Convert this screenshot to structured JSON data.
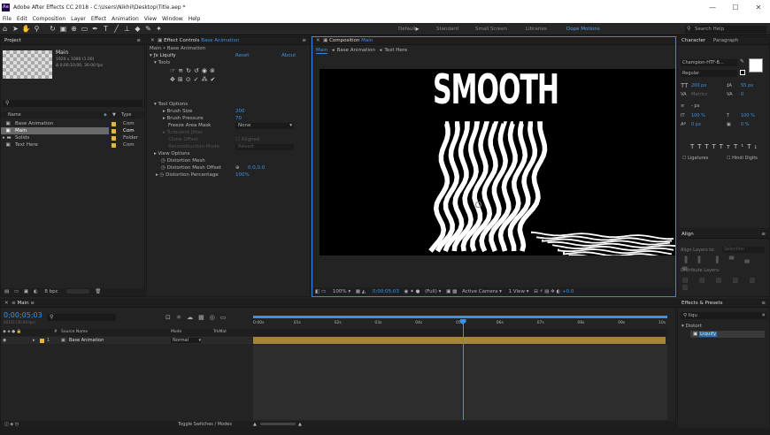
{
  "window": {
    "title": "Adobe After Effects CC 2018 - C:\\Users\\Nikhil\\Desktop\\Title.aep *",
    "app_icon": "Ae"
  },
  "menu": [
    "File",
    "Edit",
    "Composition",
    "Layer",
    "Effect",
    "Animation",
    "View",
    "Window",
    "Help"
  ],
  "workspaces": [
    "Default",
    "Standard",
    "Small Screen",
    "Libraries",
    "Dope Motions"
  ],
  "search_help_placeholder": "Search Help",
  "project": {
    "tab": "Project",
    "preview_name": "Main",
    "preview_info1": "1920 x 1080 (1.00)",
    "preview_info2": "Δ 0;00;10;00, 30.00 fps",
    "search_placeholder": "",
    "col_name": "Name",
    "col_type": "Type",
    "items": [
      {
        "name": "Base Animation",
        "type": "Com",
        "color": "#e5b53c",
        "selected": false
      },
      {
        "name": "Main",
        "type": "Com",
        "color": "#e5b53c",
        "selected": true
      },
      {
        "name": "Solids",
        "type": "Folder",
        "color": "#e5b53c",
        "selected": false
      },
      {
        "name": "Text Here",
        "type": "Com",
        "color": "#e5b53c",
        "selected": false
      }
    ],
    "bpc": "8 bpc"
  },
  "effect_controls": {
    "tab": "Effect Controls",
    "tab_target": "Base Animation",
    "layer_path": "Main • Base Animation",
    "effect_name": "Liquify",
    "reset": "Reset",
    "about": "About",
    "tools_label": "Tools",
    "tool_options": "Tool Options",
    "brush_size_label": "Brush Size",
    "brush_size": "200",
    "brush_pressure_label": "Brush Pressure",
    "brush_pressure": "70",
    "freeze_label": "Freeze Area Mask",
    "freeze_value": "None",
    "turbulent_jitter": "Turbulent Jitter",
    "clone_offset": "Clone Offset",
    "aligned": "Aligned",
    "recon_mode": "Reconstruction Mode",
    "recon_value": "Revert",
    "view_options": "View Options",
    "dist_mesh": "Distortion Mesh",
    "dist_offset_label": "Distortion Mesh Offset",
    "dist_offset": "0.0,0.0",
    "dist_pct_label": "Distortion Percentage",
    "dist_pct": "100%"
  },
  "composition": {
    "tab": "Composition",
    "tab_target": "Main",
    "crumbs": [
      "Main",
      "Base Animation",
      "Text Here"
    ],
    "text": "SMOOTH",
    "zoom": "100%",
    "timecode": "0;00;05;03",
    "resolution": "(Full)",
    "camera": "Active Camera",
    "views": "1 View",
    "exposure": "+0.0"
  },
  "timeline": {
    "tab": "Main",
    "timecode": "0;00;05;03",
    "fps_info": "00153 (30.00 fps)",
    "search_placeholder": "",
    "col_source": "Source Name",
    "col_mode": "Mode",
    "col_trkmat": "TrkMat",
    "layer_num": "1",
    "layer_name": "Base Animation",
    "layer_mode": "Normal",
    "ruler": [
      "0:00s",
      "01s",
      "02s",
      "03s",
      "04s",
      "05s",
      "06s",
      "07s",
      "08s",
      "09s",
      "10s"
    ],
    "playhead_seconds": 5.1,
    "duration_seconds": 10,
    "footer": "Toggle Switches / Modes"
  },
  "character": {
    "tab": "Character",
    "tab2": "Paragraph",
    "font": "Champion-HTF-B...",
    "style": "Regular",
    "size": "200 px",
    "leading": "55 px",
    "kerning": "Metrics",
    "tracking": "0",
    "stroke": "- px",
    "vscale": "100 %",
    "hscale": "100 %",
    "baseline": "0 px",
    "tsume": "0 %",
    "styles": [
      "T",
      "T",
      "TT",
      "Tт",
      "T¹",
      "T₁"
    ],
    "ligatures": "Ligatures",
    "hindi": "Hindi Digits"
  },
  "align": {
    "tab": "Align",
    "align_to_label": "Align Layers to:",
    "align_to": "Selection",
    "distribute": "Distribute Layers:"
  },
  "effects_presets": {
    "tab": "Effects & Presets",
    "search": "liqu",
    "group": "Distort",
    "item": "Liquify"
  },
  "colors": {
    "accent": "#2d8ceb",
    "playhead": "#2d8ceb",
    "layer_bar": "#a8833a",
    "label_yellow": "#e5b53c"
  }
}
